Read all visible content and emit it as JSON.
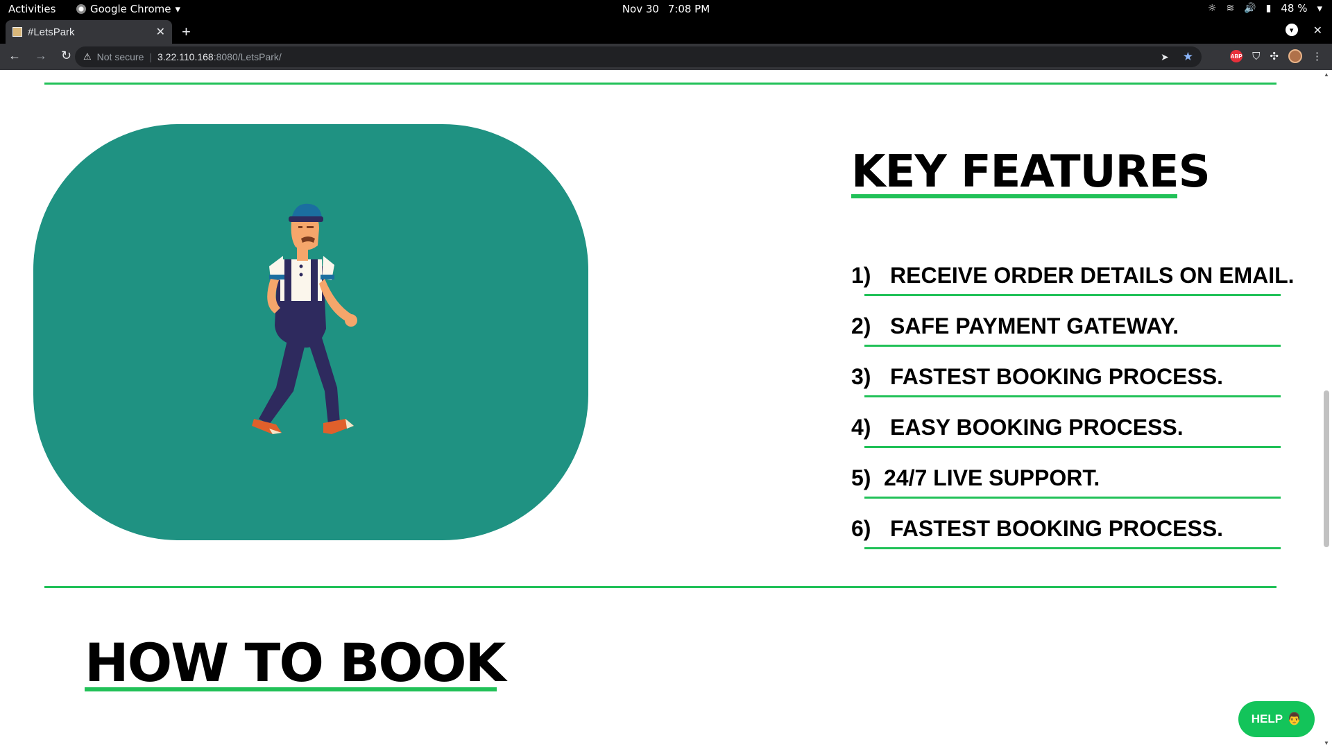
{
  "system_bar": {
    "activities": "Activities",
    "app_name": "Google Chrome",
    "date": "Nov 30",
    "time": "7:08 PM",
    "battery": "48 %"
  },
  "browser": {
    "tab_title": "#LetsPark",
    "security_label": "Not secure",
    "url_host": "3.22.110.168",
    "url_rest": ":8080/LetsPark/"
  },
  "page": {
    "key_features_title": "KEY FEATURES",
    "features": [
      {
        "num": "1)",
        "text": "RECEIVE ORDER DETAILS ON EMAIL."
      },
      {
        "num": "2)",
        "text": "SAFE PAYMENT GATEWAY."
      },
      {
        "num": "3)",
        "text": "FASTEST BOOKING PROCESS."
      },
      {
        "num": "4)",
        "text": "EASY BOOKING PROCESS."
      },
      {
        "num": "5)",
        "text": "24/7 LIVE SUPPORT."
      },
      {
        "num": "6)",
        "text": "FASTEST BOOKING PROCESS."
      }
    ],
    "how_to_book_title": "HOW TO BOOK",
    "help_label": "HELP"
  },
  "colors": {
    "accent_green": "#21c158",
    "hero_teal": "#1f9282",
    "help_button": "#13c45a"
  }
}
